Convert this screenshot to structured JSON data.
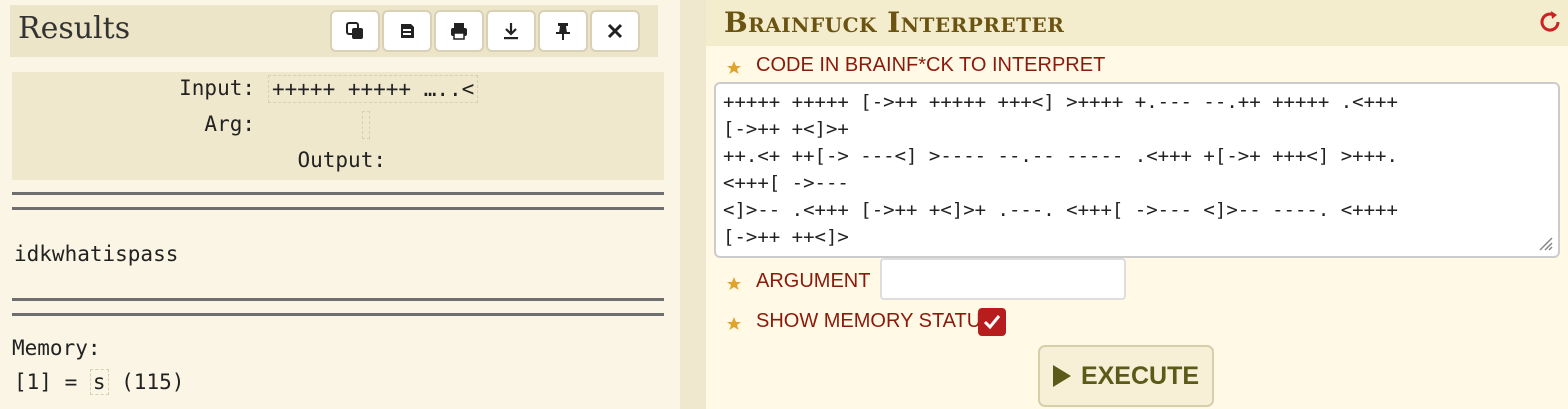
{
  "results": {
    "title": "Results",
    "toolbar": [
      {
        "icon": "copy-icon"
      },
      {
        "icon": "clear-icon"
      },
      {
        "icon": "print-icon"
      },
      {
        "icon": "download-icon"
      },
      {
        "icon": "pin-icon"
      },
      {
        "icon": "close-icon"
      }
    ],
    "input_label": "Input:",
    "input_value": "+++++ +++++ …..<",
    "arg_label": "Arg:",
    "arg_value": "",
    "output_label": "Output:",
    "output_value": "",
    "output_text": "idkwhatispass",
    "memory_label": "Memory:",
    "memory_index": "[1] = ",
    "memory_char": "s",
    "memory_code": " (115)"
  },
  "interpreter": {
    "title": "Brainfuck Interpreter",
    "code_label": "CODE IN BRAINF*CK TO INTERPRET",
    "code_value": "+++++ +++++ [->++ +++++ +++<] >++++ +.--- --.++ +++++ .<+++\n[->++ +<]>+\n++.<+ ++[-> ---<] >---- --.-- ----- .<+++ +[->+ +++<] >+++.\n<+++[ ->---\n<]>-- .<+++ [->++ +<]>+ .---. <+++[ ->--- <]>-- ----. <++++\n[->++ ++<]>",
    "argument_label": "ARGUMENT",
    "argument_value": "",
    "memory_status_label": "SHOW MEMORY STATUS",
    "memory_status_checked": true,
    "execute_label": "EXECUTE"
  },
  "colors": {
    "accent_red": "#8b1a0b",
    "title_brown": "#6b5412",
    "checkbox_red": "#b81d1d"
  }
}
